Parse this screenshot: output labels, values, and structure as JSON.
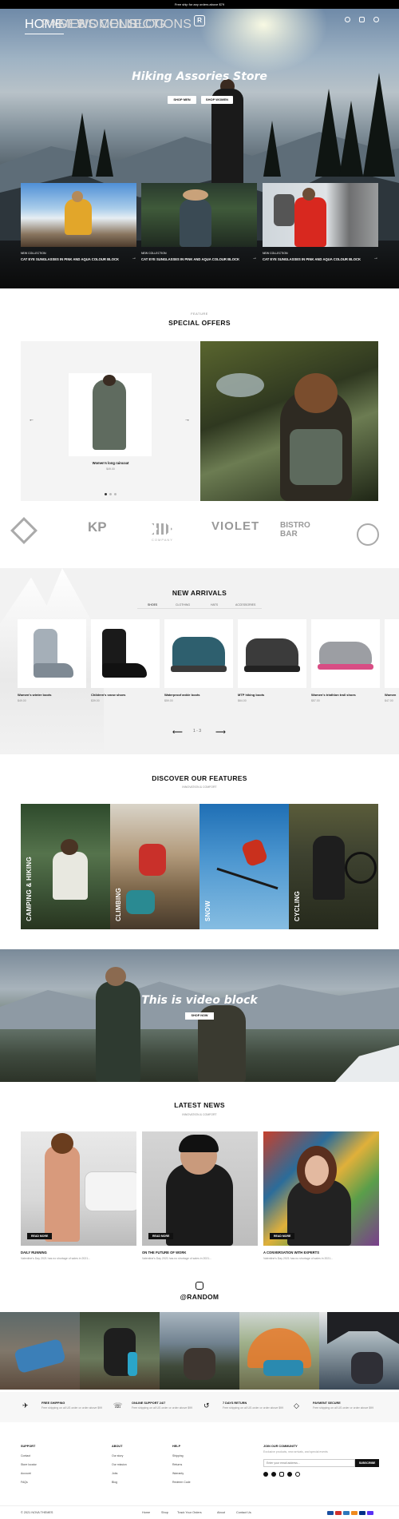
{
  "topbar": {
    "text": "Free ship for any orders above $79"
  },
  "nav": {
    "items": [
      "HOME",
      "PAGES",
      "MENS",
      "WOMENS",
      "COLLECTIONS",
      "BLOG"
    ],
    "logo": "R"
  },
  "hero": {
    "title": "Hiking Assories Store",
    "btn_men": "SHOP MEN",
    "btn_women": "SHOP WOMEN",
    "cards": [
      {
        "tag": "NEW COLLECTION",
        "title": "CAT EYE SUNGLASSES IN PINK AND AQUA COLOUR BLOCK"
      },
      {
        "tag": "NEW COLLECTION",
        "title": "CAT EYE SUNGLASSES IN PINK AND AQUA COLOUR BLOCK"
      },
      {
        "tag": "NEW COLLECTION",
        "title": "CAT EYE SUNGLASSES IN PINK AND AQUA COLOUR BLOCK"
      }
    ]
  },
  "offers": {
    "eyebrow": "FEATURE",
    "title": "SPECIAL OFFERS",
    "product_name": "Women's long raincoat",
    "product_price": "$49.00"
  },
  "brands": [
    "KP",
    "COMPANY",
    "VIOLET",
    "BISTRO BAR"
  ],
  "arrivals": {
    "title": "NEW ARRIVALS",
    "tabs": [
      "SHOES",
      "CLOTHING",
      "HATS",
      "ACCESSORIES"
    ],
    "products": [
      {
        "name": "Women's winter boots",
        "price": "$49.00"
      },
      {
        "name": "Children's snow shoes",
        "price": "$39.00"
      },
      {
        "name": "Waterproof ankle boots",
        "price": "$59.00"
      },
      {
        "name": "MTP hiking boots",
        "price": "$64.00"
      },
      {
        "name": "Women's triathlon trail shoes",
        "price": "$57.00"
      },
      {
        "name": "Women",
        "price": "$47.00"
      }
    ],
    "pager": "1 - 3"
  },
  "features": {
    "title": "DISCOVER OUR FEATURES",
    "sub": "INNOVATION & COMFORT",
    "items": [
      "CAMPING & HIKING",
      "CLIMBING",
      "SNOW",
      "CYCLING"
    ]
  },
  "video": {
    "title": "This is video block",
    "btn": "SHOP NOW"
  },
  "news": {
    "title": "LATEST NEWS",
    "sub": "INNOVATION & COMFORT",
    "btn": "READ MORE",
    "items": [
      {
        "title": "DAILY RUNNING",
        "date": "Valentine's Day 2021 has no shortage of sales in 2021..."
      },
      {
        "title": "ON THE FUTURE OF WORK",
        "date": "Valentine's Day 2021 has no shortage of sales in 2021..."
      },
      {
        "title": "A CONVERSATION WITH EXPERTS",
        "date": "Valentine's Day 2021 has no shortage of sales in 2021..."
      }
    ]
  },
  "instagram": {
    "title": "@RANDOM"
  },
  "services": [
    {
      "title": "FREE SHIPPING",
      "desc": "Free shipping on all US order or order above $99"
    },
    {
      "title": "ONLINE SUPPORT 24/7",
      "desc": "Free shipping on all US order or order above $99"
    },
    {
      "title": "7 DAYS RETURN",
      "desc": "Free shipping on all US order or order above $99"
    },
    {
      "title": "PAYMENT SECURE",
      "desc": "Free shipping on all US order or order above $99"
    }
  ],
  "footer": {
    "support": {
      "head": "SUPPORT",
      "links": [
        "Contact",
        "Store locator",
        "Account",
        "FAQs"
      ]
    },
    "about": {
      "head": "ABOUT",
      "links": [
        "Our story",
        "Our mission",
        "Jobs",
        "Blog"
      ]
    },
    "help": {
      "head": "HELP",
      "links": [
        "Shipping",
        "Returns",
        "Warranty",
        "Redeem Code"
      ]
    },
    "community": {
      "head": "JOIN OUR COMMUNITY",
      "desc": "Exclusive products, new arrivals, and special events",
      "placeholder": "Enter your email address...",
      "btn": "SUBSCRIBE"
    },
    "copyright": "© 2021 NOVA THEMES",
    "bottom_links": [
      "Home",
      "Shop",
      "Track Your Orders",
      "About",
      "Contact Us"
    ]
  },
  "colors": {
    "dark": "#111111",
    "hero_bg": "#0a0a0a",
    "light_bg": "#f2f2f2"
  }
}
